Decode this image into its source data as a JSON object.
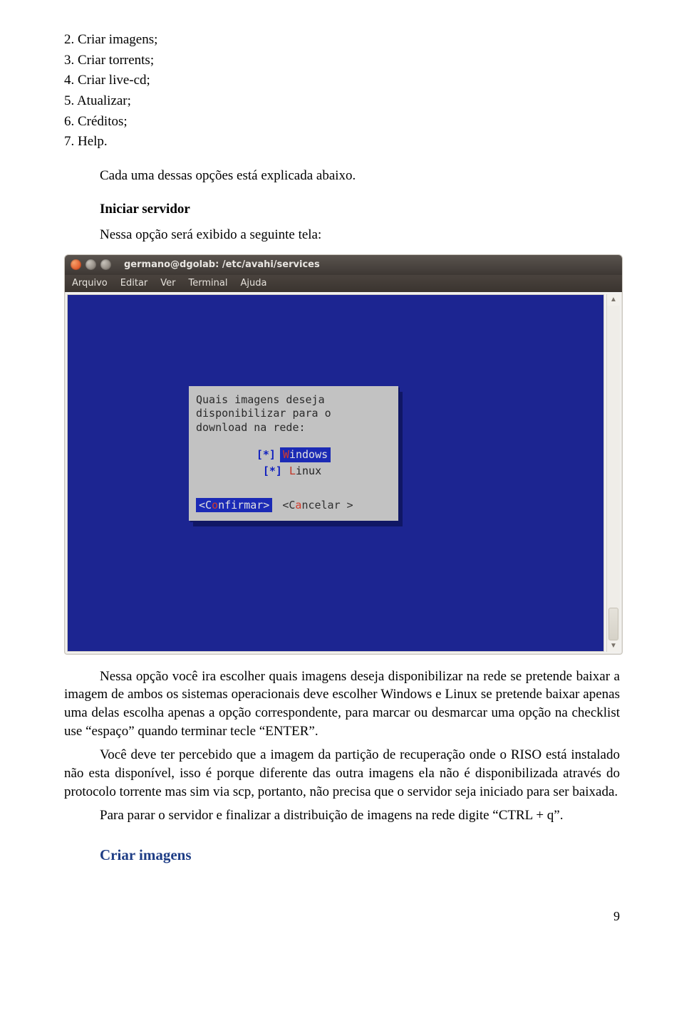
{
  "list": [
    {
      "n": "2.",
      "t": "Criar imagens;"
    },
    {
      "n": "3.",
      "t": "Criar torrents;"
    },
    {
      "n": "4.",
      "t": "Criar live-cd;"
    },
    {
      "n": "5.",
      "t": "Atualizar;"
    },
    {
      "n": "6.",
      "t": "Créditos;"
    },
    {
      "n": "7.",
      "t": "Help."
    }
  ],
  "intro_para": "Cada uma dessas opções está explicada abaixo.",
  "heading1": "Iniciar servidor",
  "heading1_sub": "Nessa opção será exibido a seguinte tela:",
  "screenshot": {
    "title": "germano@dgolab: /etc/avahi/services",
    "menus": [
      "Arquivo",
      "Editar",
      "Ver",
      "Terminal",
      "Ajuda"
    ],
    "dialog": {
      "prompt_l1": "Quais imagens deseja",
      "prompt_l2": "disponibilizar para o",
      "prompt_l3": "download na rede:",
      "opt1_mark": "[*]",
      "opt1_hot": "W",
      "opt1_rest": "indows",
      "opt2_mark": "[*]",
      "opt2_hot": "L",
      "opt2_rest": "inux",
      "btn1_pre": "<C",
      "btn1_hot": "o",
      "btn1_post": "nfirmar>",
      "btn2_pre": "<C",
      "btn2_hot": "a",
      "btn2_post": "ncelar >"
    }
  },
  "para1": "Nessa opção você ira escolher quais imagens deseja disponibilizar na rede se pretende baixar a imagem de ambos os sistemas operacionais deve escolher Windows e Linux se pretende baixar apenas uma delas escolha apenas a opção correspondente, para marcar ou desmarcar uma opção na checklist use “espaço” quando terminar tecle “ENTER”.",
  "para2": "Você deve ter percebido que a imagem da partição de recuperação onde o RISO está instalado não esta disponível, isso é porque diferente das outra imagens ela não é disponibilizada através do protocolo torrente mas sim via scp, portanto, não precisa que o servidor seja iniciado para ser baixada.",
  "para3": "Para parar o servidor e finalizar a distribuição de imagens na rede digite “CTRL + q”.",
  "section_heading": "Criar imagens",
  "page_number": "9"
}
